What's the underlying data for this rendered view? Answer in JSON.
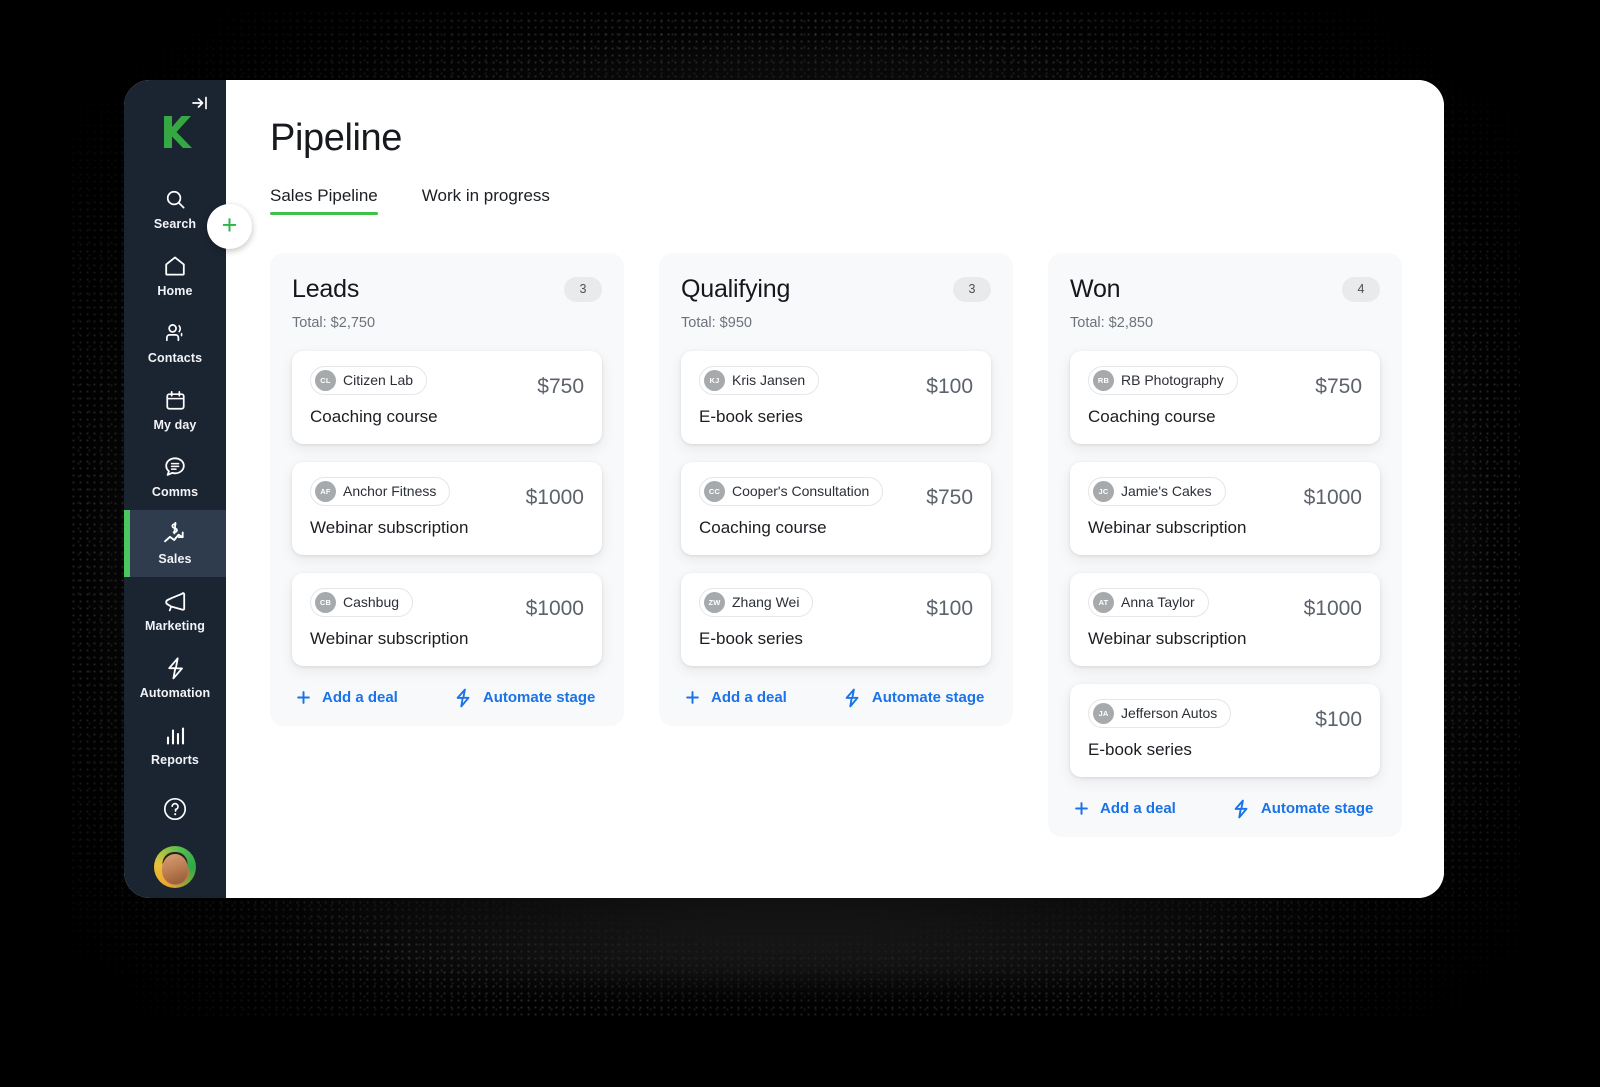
{
  "app": {
    "logo_name": "keap-logo",
    "collapse_label": "collapse-sidebar"
  },
  "sidebar": {
    "add_label": "+",
    "items": [
      {
        "label": "Search",
        "icon": "search-icon",
        "active": false
      },
      {
        "label": "Home",
        "icon": "home-icon",
        "active": false
      },
      {
        "label": "Contacts",
        "icon": "contacts-icon",
        "active": false
      },
      {
        "label": "My day",
        "icon": "calendar-icon",
        "active": false
      },
      {
        "label": "Comms",
        "icon": "chat-icon",
        "active": false
      },
      {
        "label": "Sales",
        "icon": "sales-chart-icon",
        "active": true
      },
      {
        "label": "Marketing",
        "icon": "megaphone-icon",
        "active": false
      },
      {
        "label": "Automation",
        "icon": "lightning-icon",
        "active": false
      },
      {
        "label": "Reports",
        "icon": "bar-chart-icon",
        "active": false
      }
    ],
    "help_label": "help-icon",
    "avatar_label": "user-avatar"
  },
  "header": {
    "title": "Pipeline",
    "tabs": [
      {
        "label": "Sales Pipeline",
        "active": true
      },
      {
        "label": "Work in progress",
        "active": false
      }
    ]
  },
  "board": {
    "add_deal_label": "Add a deal",
    "automate_label": "Automate stage",
    "columns": [
      {
        "title": "Leads",
        "count": "3",
        "total": "Total: $2,750",
        "deals": [
          {
            "initials": "CL",
            "contact": "Citizen Lab",
            "name": "Coaching course",
            "amount": "$750"
          },
          {
            "initials": "AF",
            "contact": "Anchor Fitness",
            "name": "Webinar subscription",
            "amount": "$1000"
          },
          {
            "initials": "CB",
            "contact": "Cashbug",
            "name": "Webinar subscription",
            "amount": "$1000"
          }
        ]
      },
      {
        "title": "Qualifying",
        "count": "3",
        "total": "Total: $950",
        "deals": [
          {
            "initials": "KJ",
            "contact": "Kris Jansen",
            "name": "E-book series",
            "amount": "$100"
          },
          {
            "initials": "CC",
            "contact": "Cooper's Consultation",
            "name": "Coaching course",
            "amount": "$750"
          },
          {
            "initials": "ZW",
            "contact": "Zhang Wei",
            "name": "E-book series",
            "amount": "$100"
          }
        ]
      },
      {
        "title": "Won",
        "count": "4",
        "total": "Total: $2,850",
        "deals": [
          {
            "initials": "RB",
            "contact": "RB Photography",
            "name": "Coaching course",
            "amount": "$750"
          },
          {
            "initials": "JC",
            "contact": "Jamie's Cakes",
            "name": "Webinar subscription",
            "amount": "$1000"
          },
          {
            "initials": "AT",
            "contact": "Anna Taylor",
            "name": "Webinar subscription",
            "amount": "$1000"
          },
          {
            "initials": "JA",
            "contact": "Jefferson Autos",
            "name": "E-book series",
            "amount": "$100"
          }
        ]
      }
    ]
  },
  "colors": {
    "accent_green": "#3ec246",
    "link_blue": "#1a73e8",
    "sidebar_bg": "#1b2431",
    "sidebar_active": "#2e3c4e",
    "column_bg": "#f8f9fa"
  }
}
